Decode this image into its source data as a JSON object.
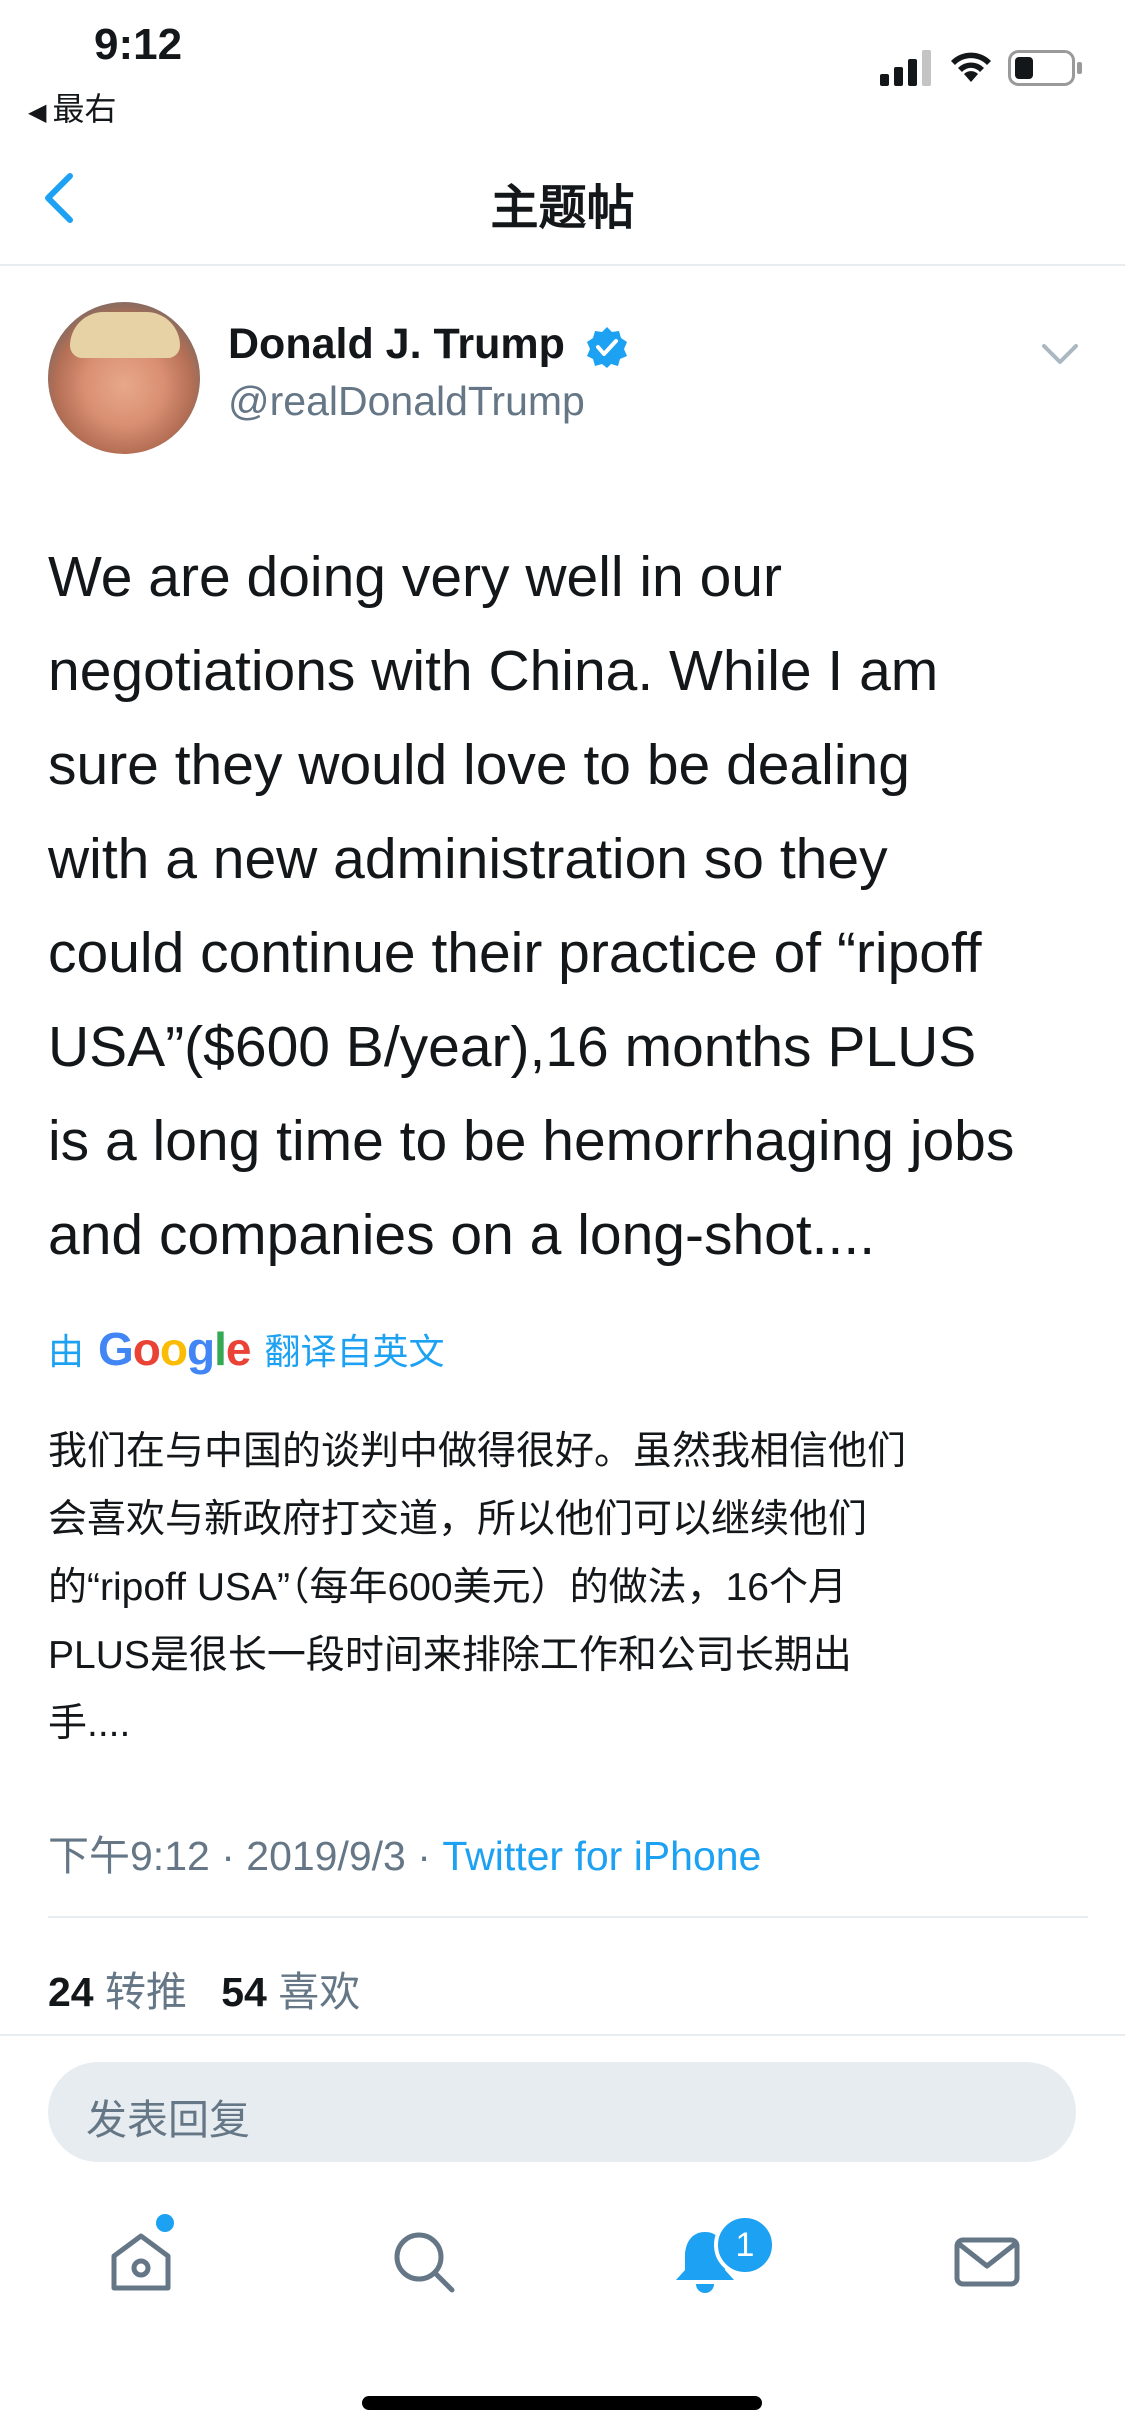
{
  "status_bar": {
    "time": "9:12",
    "back_label": "最右",
    "icons": [
      "signal-icon",
      "wifi-icon",
      "battery-icon"
    ]
  },
  "nav": {
    "title": "主题帖"
  },
  "tweet": {
    "display_name": "Donald J. Trump",
    "handle": "@realDonaldTrump",
    "text": "We are doing very well in our\nnegotiations with China. While I am\nsure they would love to be dealing\nwith a new administration so they\ncould continue their practice of “ripoff\nUSA”($600 B/year),16 months PLUS\nis a long time to be hemorrhaging jobs\nand companies on a long-shot....",
    "translate_prefix": "由",
    "translate_suffix": "翻译自英文",
    "google_logo": "Google",
    "translated_text": "我们在与中国的谈判中做得很好。虽然我相信他们\n会喜欢与新政府打交道，所以他们可以继续他们\n的“ripoff USA”（每年600美元）的做法，16个月\nPLUS是很长一段时间来排除工作和公司长期出\n手....",
    "time": "下午9:12",
    "date": "2019/9/3",
    "source": "Twitter for iPhone",
    "retweets_count": "24",
    "retweets_label": "转推",
    "likes_count": "54",
    "likes_label": "喜欢"
  },
  "reply": {
    "placeholder": "发表回复"
  },
  "tab_bar": {
    "items": [
      "home-icon",
      "search-icon",
      "notifications-icon",
      "messages-icon"
    ],
    "notification_badge": "1"
  },
  "colors": {
    "accent": "#1da1f2",
    "secondary_text": "#657786",
    "divider": "#e6ecf0"
  }
}
